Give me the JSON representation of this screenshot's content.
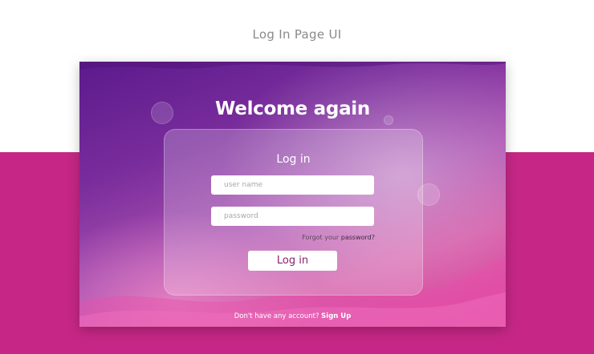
{
  "page": {
    "heading": "Log In Page UI"
  },
  "colors": {
    "background_top": "#ffffff",
    "background_bottom": "#c62786",
    "card_gradient_start": "#5b1a8c",
    "card_gradient_end": "#e0479c",
    "button_text": "#8b1f6b"
  },
  "card": {
    "welcome": "Welcome again",
    "form": {
      "title": "Log in",
      "username_placeholder": "user name",
      "password_placeholder": "password",
      "forgot_prefix": "Forgot your ",
      "forgot_link": "password?",
      "submit_label": "Log in"
    },
    "footer": {
      "prompt": "Don't have any account? ",
      "signup_label": "Sign Up"
    }
  }
}
